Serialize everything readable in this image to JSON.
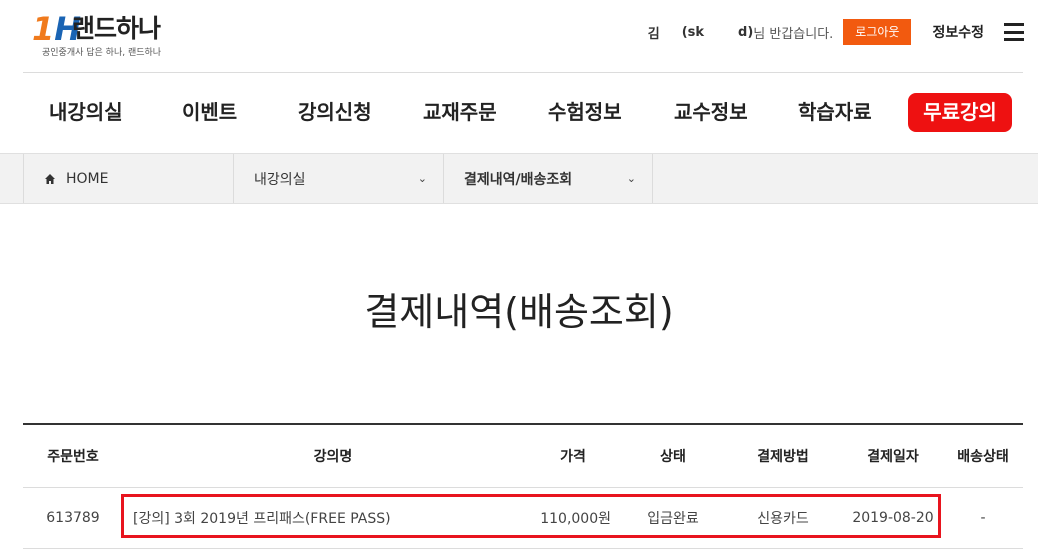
{
  "logo": {
    "mark_one": "1",
    "mark_h": "H",
    "name": "랜드하나",
    "tagline": "공인중개사 답은 하나, 랜드하나"
  },
  "user": {
    "name_first": "김",
    "name_mid": "(sk",
    "name_end": "d)",
    "greeting": " 님 반갑습니다.",
    "logout_label": "로그아웃",
    "edit_label": "정보수정"
  },
  "gnb": {
    "items": [
      "내강의실",
      "이벤트",
      "강의신청",
      "교재주문",
      "수험정보",
      "교수정보",
      "학습자료"
    ],
    "free_label": "무료강의"
  },
  "breadcrumb": {
    "home": "HOME",
    "level1": "내강의실",
    "level2": "결제내역/배송조회"
  },
  "page": {
    "title": "결제내역(배송조회)"
  },
  "table": {
    "headers": {
      "order": "주문번호",
      "name": "강의명",
      "price": "가격",
      "status": "상태",
      "method": "결제방법",
      "date": "결제일자",
      "ship": "배송상태"
    },
    "rows": [
      {
        "order": "613789",
        "name": "[강의] 3회 2019년 프리패스(FREE PASS)",
        "price": "110,000원",
        "status": "입금완료",
        "method": "신용카드",
        "date": "2019-08-20",
        "ship": "-"
      }
    ]
  },
  "colors": {
    "accent_orange": "#f25a0f",
    "free_red": "#ee1111",
    "highlight_red": "#e8141e",
    "logo_blue": "#1a64b4"
  }
}
